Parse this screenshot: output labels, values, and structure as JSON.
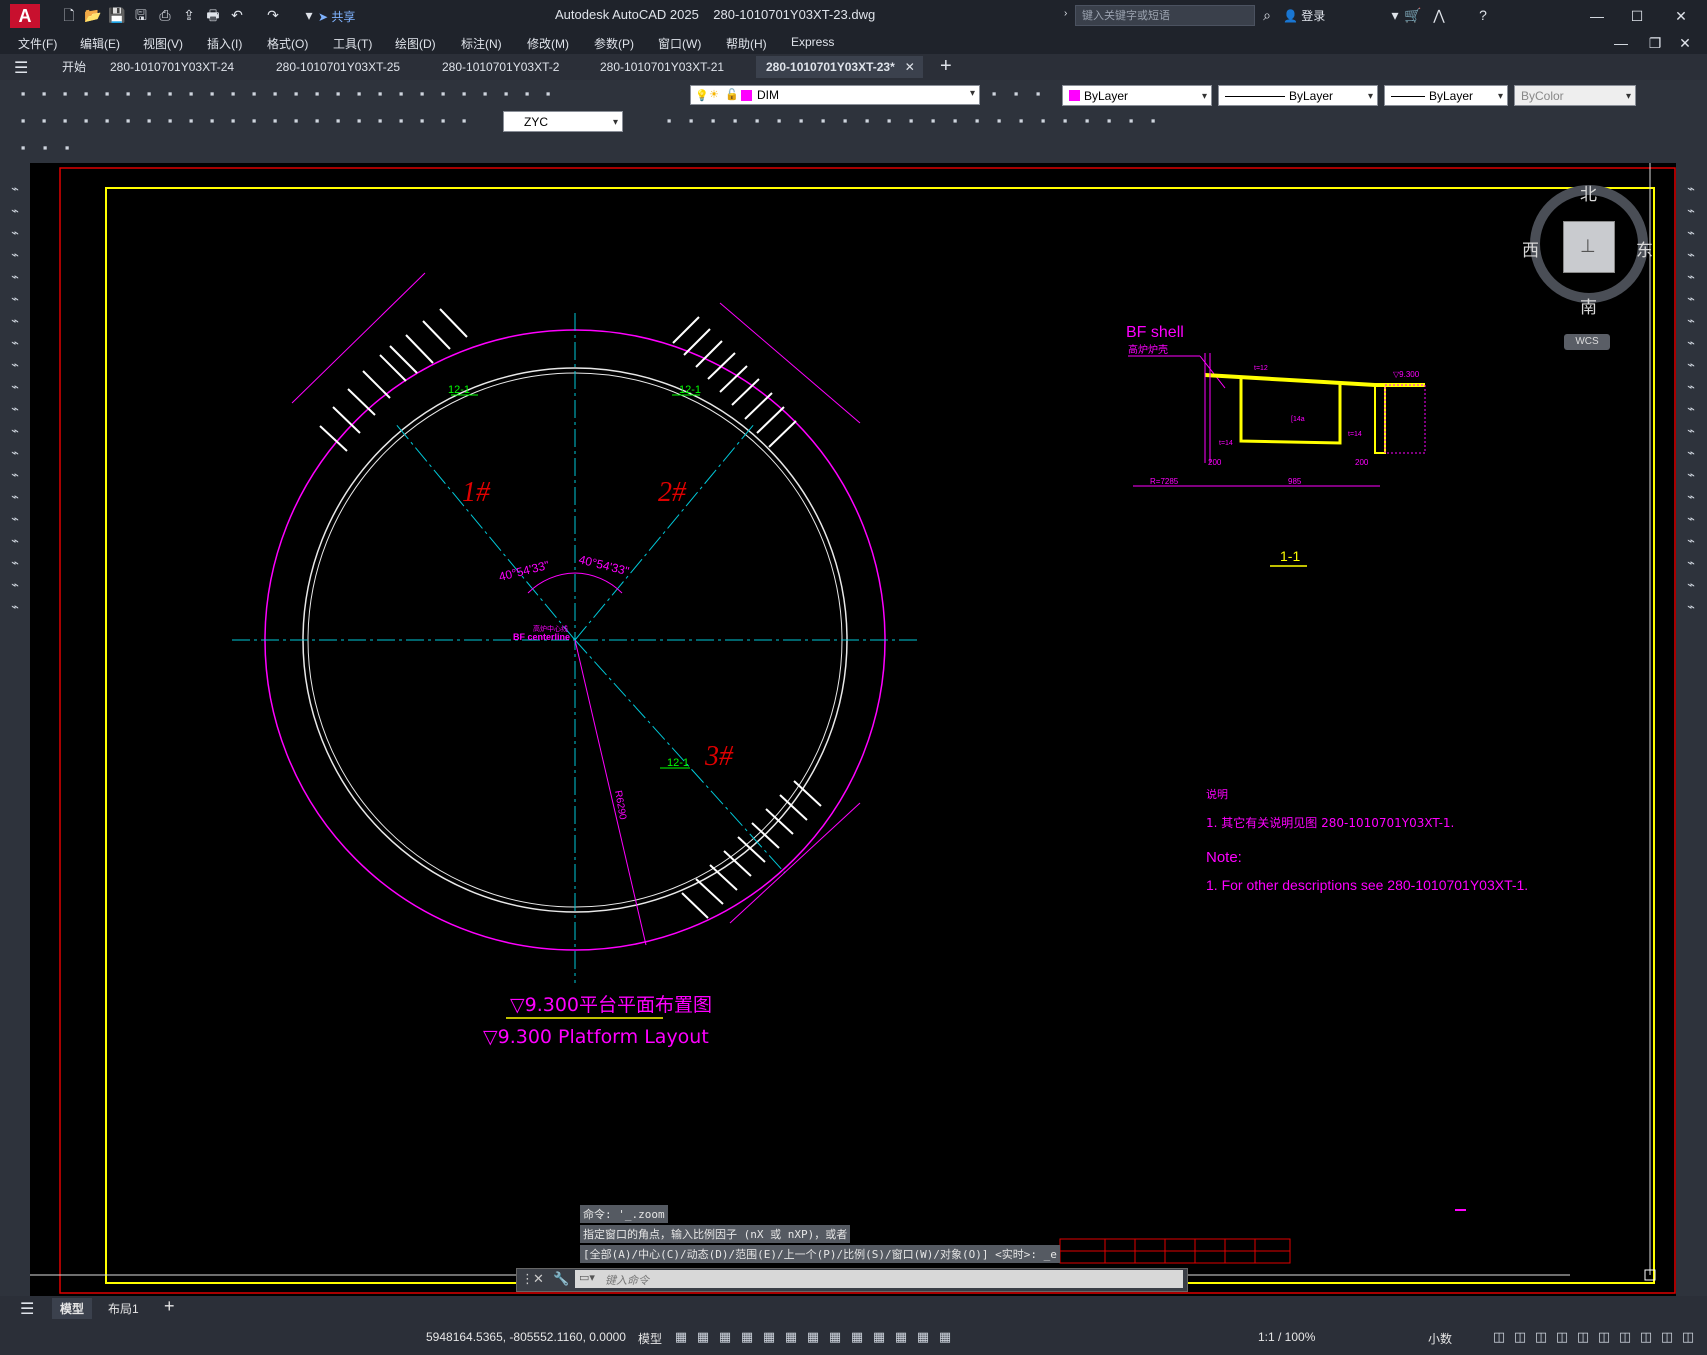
{
  "window": {
    "app_title": "Autodesk AutoCAD 2025",
    "file_title": "280-1010701Y03XT-23.dwg",
    "search_placeholder": "键入关键字或短语",
    "login_label": "登录",
    "share_label": "共享"
  },
  "menu": [
    "文件(F)",
    "编辑(E)",
    "视图(V)",
    "插入(I)",
    "格式(O)",
    "工具(T)",
    "绘图(D)",
    "标注(N)",
    "修改(M)",
    "参数(P)",
    "窗口(W)",
    "帮助(H)",
    "Express"
  ],
  "tabs": [
    {
      "label": "开始"
    },
    {
      "label": "280-1010701Y03XT-24"
    },
    {
      "label": "280-1010701Y03XT-25"
    },
    {
      "label": "280-1010701Y03XT-2"
    },
    {
      "label": "280-1010701Y03XT-21"
    },
    {
      "label": "280-1010701Y03XT-23*"
    }
  ],
  "properties": {
    "layer": "DIM",
    "color": "ByLayer",
    "linetype": "ByLayer",
    "lineweight": "ByLayer",
    "plotstyle": "ByColor",
    "dimstyle": "ZYC"
  },
  "viewcube": {
    "north": "北",
    "south": "南",
    "east": "东",
    "west": "西",
    "ucs": "WCS"
  },
  "drawing": {
    "plan_title_cn": "▽9.300平台平面布置图",
    "plan_title_en": "▽9.300 Platform Layout",
    "platform_1": "1#",
    "platform_2": "2#",
    "platform_3": "3#",
    "section_ref": "12-1",
    "angle_1": "40°54'33\"",
    "angle_2": "40°54'33\"",
    "centerline": "BF centerline",
    "centerline_cn": "高炉中心线",
    "radius": "R6290",
    "section_title": "1-1",
    "bf_shell": "BF shell",
    "bf_shell_cn": "高炉炉壳",
    "elev_mark": "▽9.300",
    "dim_200a": "200",
    "dim_985": "985",
    "dim_200b": "200",
    "dim_r": "R=7285",
    "label_t12": "t=12",
    "label_t14a": "t=14",
    "label_t14b": "t=14",
    "label_c14": "[14a",
    "notes_cn_title": "说明",
    "notes_cn_1": "1. 其它有关说明见图    280-1010701Y03XT-1.",
    "notes_en_title": "Note:",
    "notes_en_1": "1. For other descriptions see    280-1010701Y03XT-1."
  },
  "command": {
    "history_1": "命令: '_.zoom",
    "history_2": "指定窗口的角点，输入比例因子 (nX 或 nXP)，或者",
    "history_3": "[全部(A)/中心(C)/动态(D)/范围(E)/上一个(P)/比例(S)/窗口(W)/对象(O)] <实时>: _e",
    "placeholder": "键入命令"
  },
  "layout_tabs": [
    "模型",
    "布局1"
  ],
  "status": {
    "coords": "5948164.5365, -805552.1160, 0.0000",
    "model": "模型",
    "scale": "1:1 / 100%",
    "units": "小数"
  },
  "colors": {
    "magenta": "#ff00ff",
    "cyan": "#00c8d8",
    "yellow": "#ffff00",
    "green": "#00ff00",
    "red": "#e00000"
  }
}
